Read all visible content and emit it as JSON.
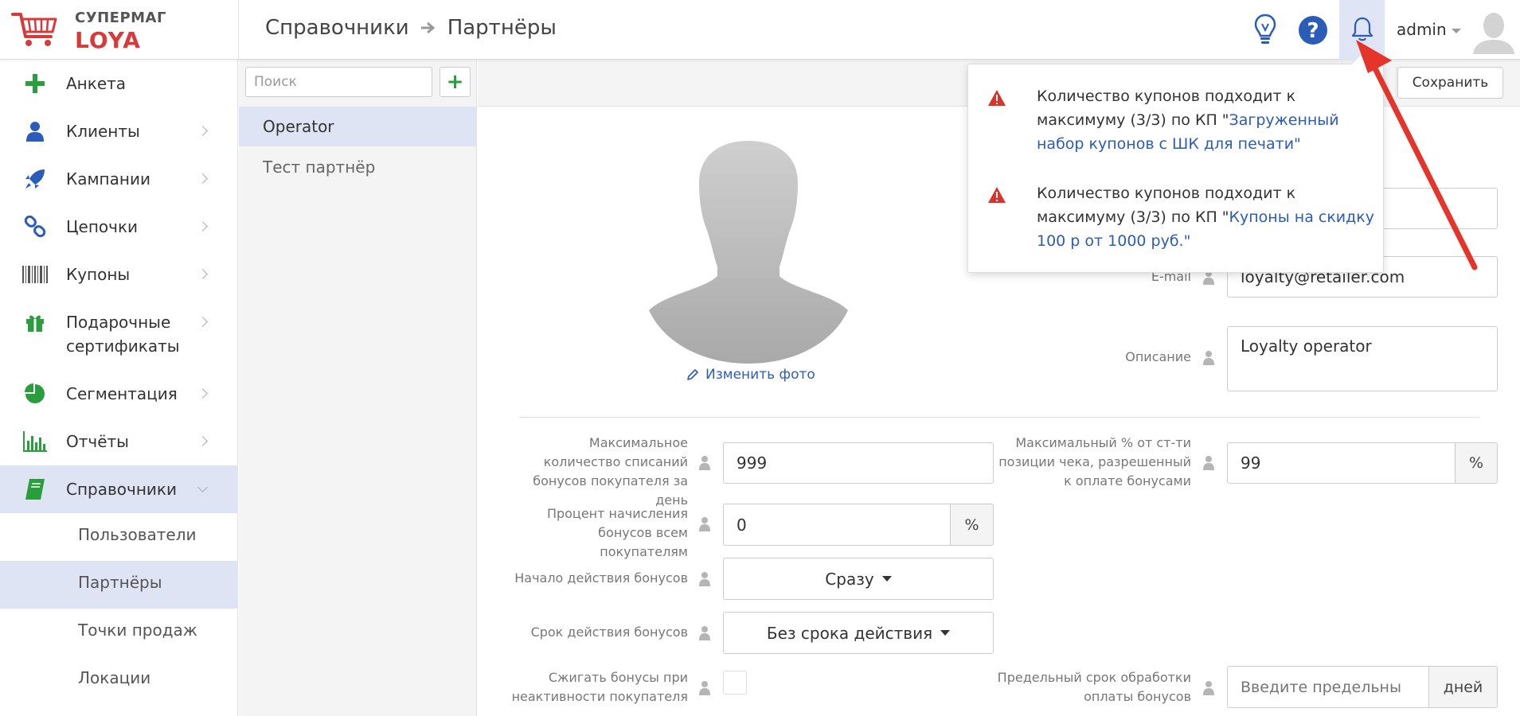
{
  "brand": {
    "name_top": "СУПЕРМАГ",
    "name_bottom": "LOYA"
  },
  "breadcrumb": [
    "Справочники",
    "Партнёры"
  ],
  "header": {
    "user": "admin"
  },
  "sidebar": {
    "items": [
      {
        "label": "Анкета",
        "icon": "plus-icon"
      },
      {
        "label": "Клиенты",
        "icon": "user-icon"
      },
      {
        "label": "Кампании",
        "icon": "rocket-icon"
      },
      {
        "label": "Цепочки",
        "icon": "chain-icon"
      },
      {
        "label": "Купоны",
        "icon": "barcode-icon"
      },
      {
        "label": "Подарочные сертификаты",
        "icon": "gift-icon"
      },
      {
        "label": "Сегментация",
        "icon": "pie-icon"
      },
      {
        "label": "Отчёты",
        "icon": "bar-chart-icon"
      },
      {
        "label": "Справочники",
        "icon": "book-icon"
      }
    ],
    "subitems": [
      "Пользователи",
      "Партнёры",
      "Точки продаж",
      "Локации"
    ]
  },
  "partners": {
    "search_placeholder": "Поиск",
    "add_label": "+",
    "items": [
      "Operator",
      "Тест партнёр"
    ]
  },
  "toolbar": {
    "save_label": "Сохранить"
  },
  "photo": {
    "change_label": "Изменить фото"
  },
  "fields": {
    "email_label": "E-mail",
    "email_value": "loyalty@retailer.com",
    "description_label": "Описание",
    "description_value": "Loyalty operator",
    "max_writeoffs_label": "Максимальное количество списаний бонусов покупателя за день",
    "max_writeoffs_value": "999",
    "max_percent_label": "Максимальный % от ст-ти позиции чека, разрешенный к оплате бонусами",
    "max_percent_value": "99",
    "max_percent_unit": "%",
    "accrual_label": "Процент начисления бонусов всем покупателям",
    "accrual_value": "0",
    "accrual_unit": "%",
    "start_label": "Начало действия бонусов",
    "start_value": "Сразу",
    "term_label": "Срок действия бонусов",
    "term_value": "Без срока действия",
    "burn_label": "Сжигать бонусы при неактивности покупателя",
    "deadline_label": "Предельный срок обработки оплаты бонусов",
    "deadline_placeholder": "Введите предельны",
    "deadline_unit": "дней"
  },
  "notifications": [
    {
      "prefix": "Количество купонов подходит к максимуму (3/3) по КП \"",
      "link": "Загруженный набор купонов с ШК для печати",
      "suffix": "\""
    },
    {
      "prefix": "Количество купонов подходит к максимуму (3/3) по КП \"",
      "link": "Купоны на скидку 100 р от 1000 руб.",
      "suffix": "\""
    }
  ],
  "colors": {
    "accent": "#2a5cb8",
    "active_bg": "#dfe4f4",
    "brand_red": "#d63b3b",
    "warning": "#d9342b",
    "green": "#2a9d3c"
  }
}
